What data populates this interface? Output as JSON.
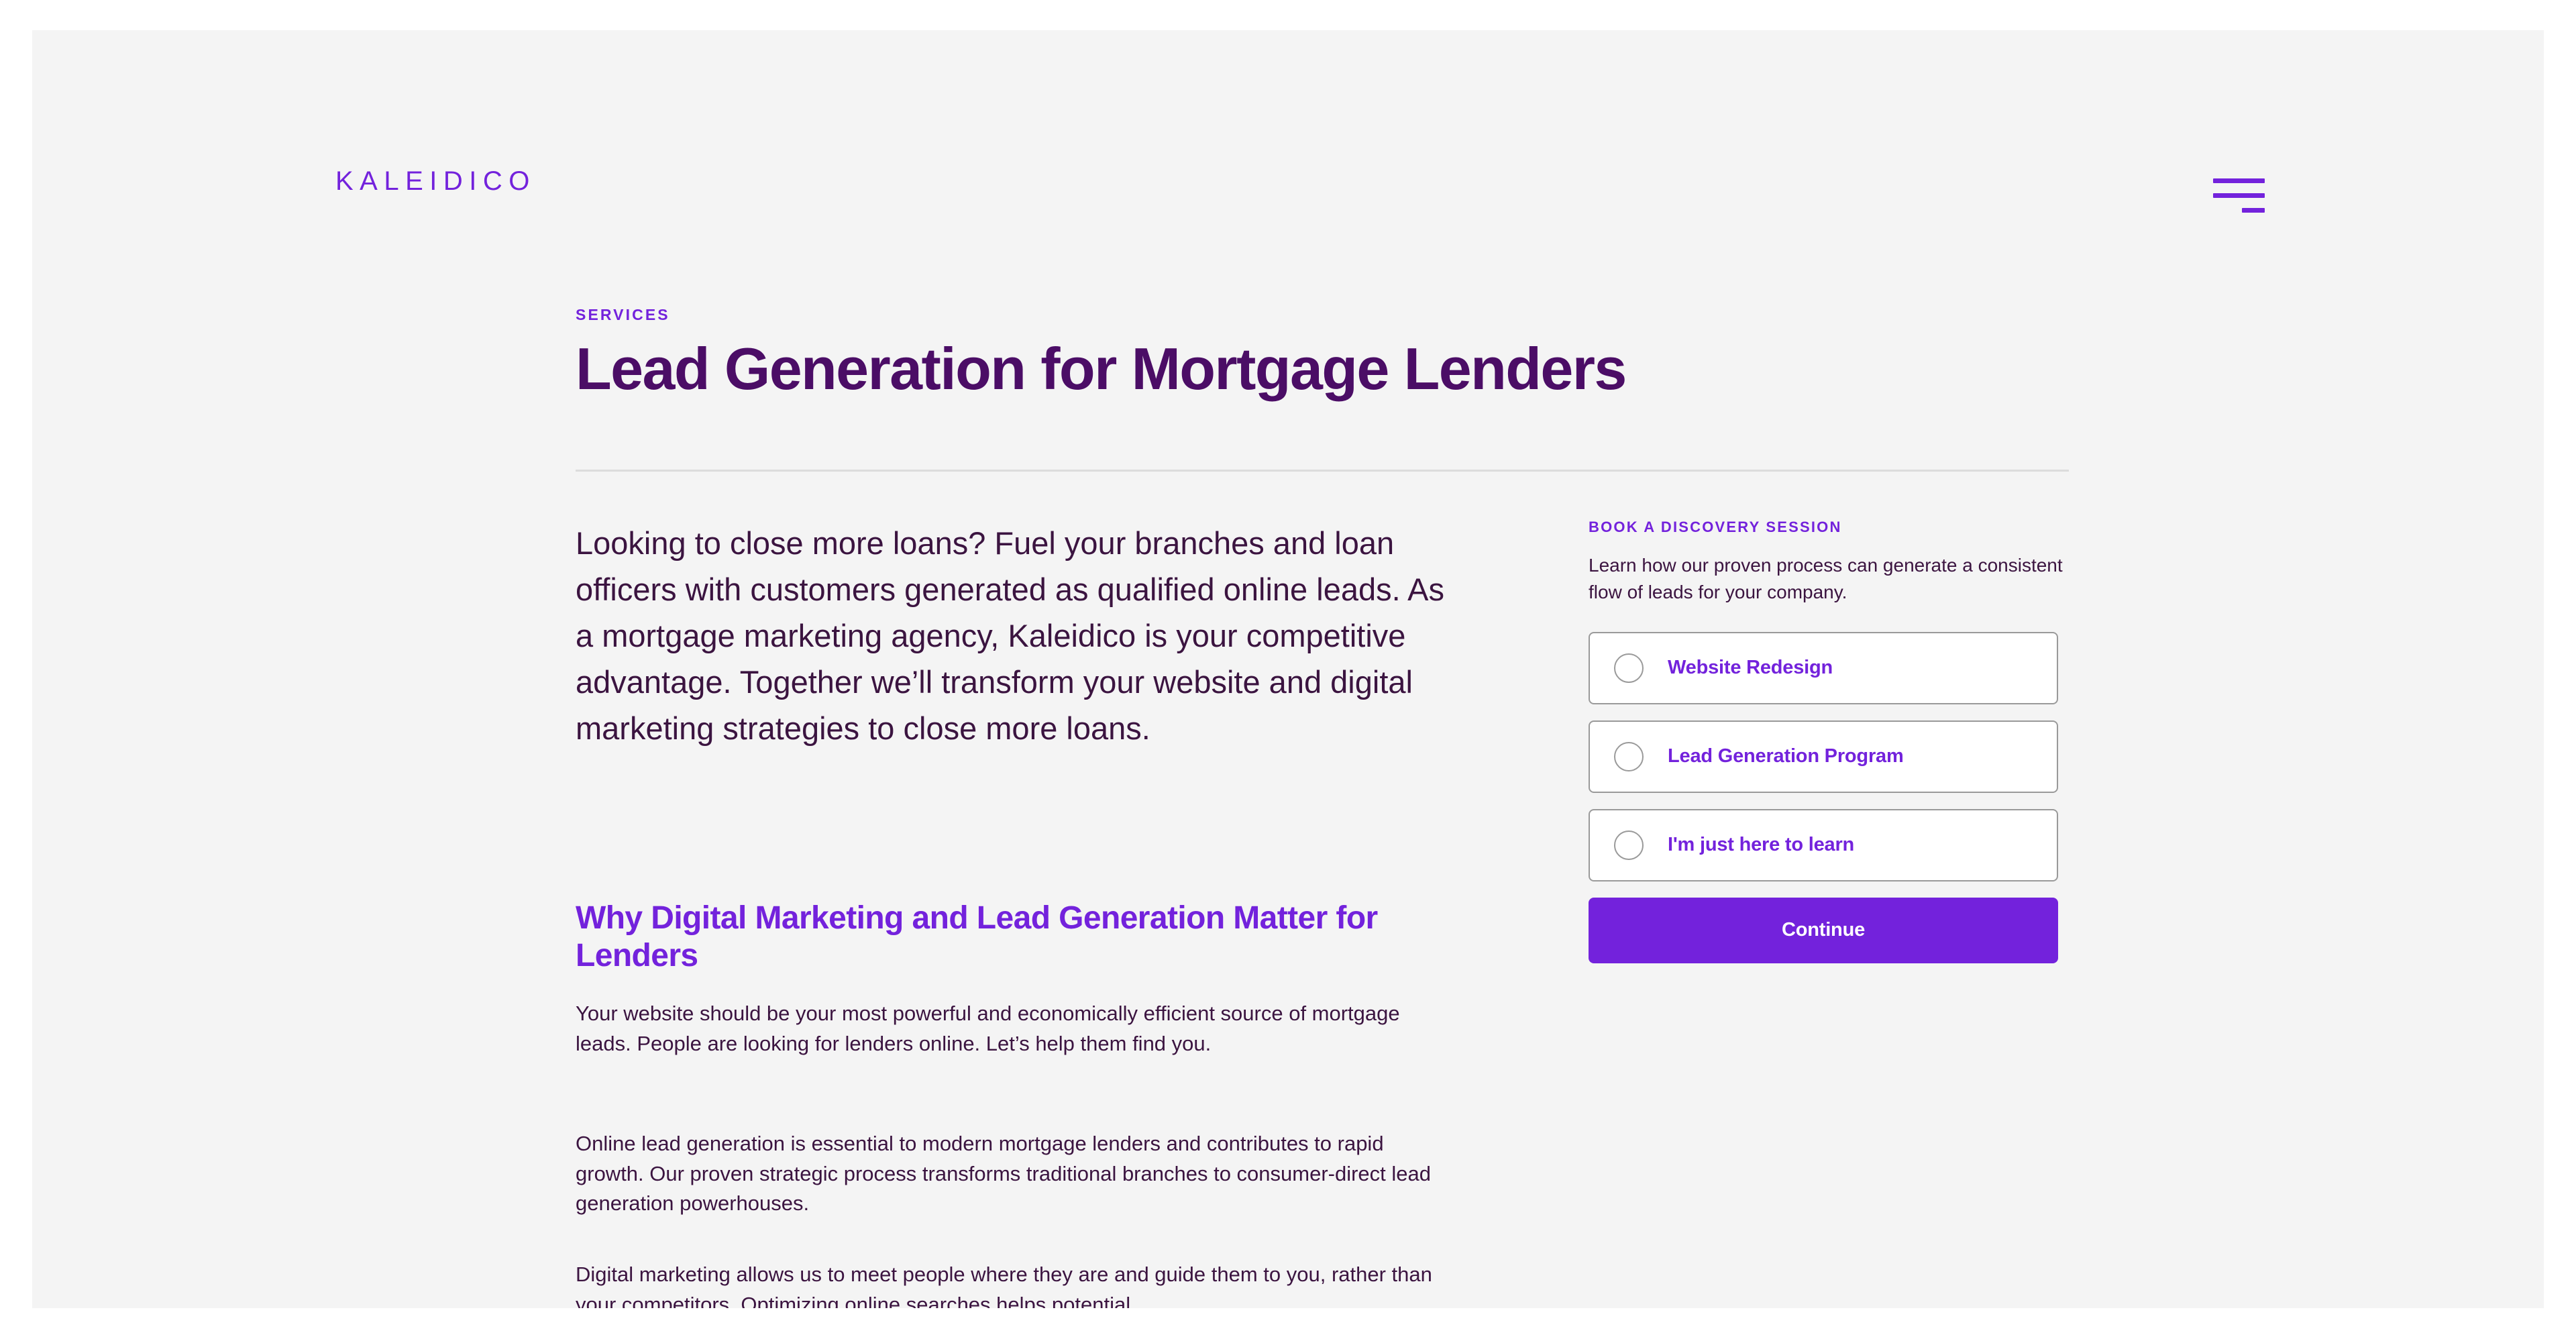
{
  "header": {
    "logo_text": "KALEIDICO",
    "menu_icon": "hamburger-menu-icon"
  },
  "hero": {
    "eyebrow": "SERVICES",
    "title": "Lead Generation for Mortgage Lenders"
  },
  "article": {
    "lede": "Looking to close more loans? Fuel your branches and loan officers with customers generated as qualified online leads. As a mortgage marketing agency, Kaleidico is your competitive advantage. Together we’ll transform your website and digital marketing strategies to close more loans.",
    "section_heading": "Why Digital Marketing and Lead Generation Matter for Lenders",
    "paragraphs": [
      "Your website should be your most powerful and economically efficient source of mortgage leads. People are looking for lenders online. Let’s help them find you.",
      "Online lead generation is essential to modern mortgage lenders and contributes to rapid growth. Our proven strategic process transforms traditional branches to consumer-direct lead generation powerhouses.",
      "Digital marketing allows us to meet people where they are and guide them to you, rather than your competitors. Optimizing online searches helps potential"
    ]
  },
  "form": {
    "eyebrow": "BOOK A DISCOVERY SESSION",
    "description": "Learn how our proven process can generate a consistent flow of leads for your company.",
    "options": [
      {
        "label": "Website Redesign",
        "selected": false
      },
      {
        "label": "Lead Generation Program",
        "selected": false
      },
      {
        "label": "I'm just here to learn",
        "selected": false
      }
    ],
    "submit_label": "Continue"
  },
  "colors": {
    "brand_purple": "#7322dc",
    "headline_purple": "#4b0d66",
    "body_text": "#3b1440",
    "page_background": "#f4f4f4",
    "card_border": "#9a9a9a",
    "divider": "#dcdcdc"
  }
}
